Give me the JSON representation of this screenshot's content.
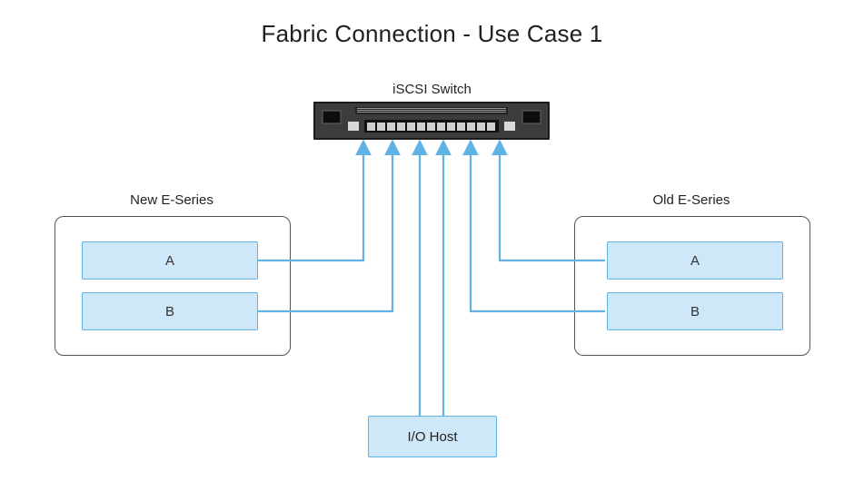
{
  "title": "Fabric Connection - Use Case 1",
  "switch": {
    "label": "iSCSI Switch"
  },
  "new_series": {
    "title": "New E-Series",
    "controller_a": "A",
    "controller_b": "B"
  },
  "old_series": {
    "title": "Old E-Series",
    "controller_a": "A",
    "controller_b": "B"
  },
  "io_host": {
    "label": "I/O Host"
  },
  "connections": [
    {
      "from": "new_series.controller_a",
      "to": "switch"
    },
    {
      "from": "new_series.controller_b",
      "to": "switch"
    },
    {
      "from": "io_host",
      "to": "switch",
      "count": 2
    },
    {
      "from": "old_series.controller_a",
      "to": "switch"
    },
    {
      "from": "old_series.controller_b",
      "to": "switch"
    }
  ],
  "colors": {
    "node_fill": "#cfe8f9",
    "node_stroke": "#60b2e5",
    "wire": "#60b2e5",
    "box_stroke": "#555555"
  }
}
